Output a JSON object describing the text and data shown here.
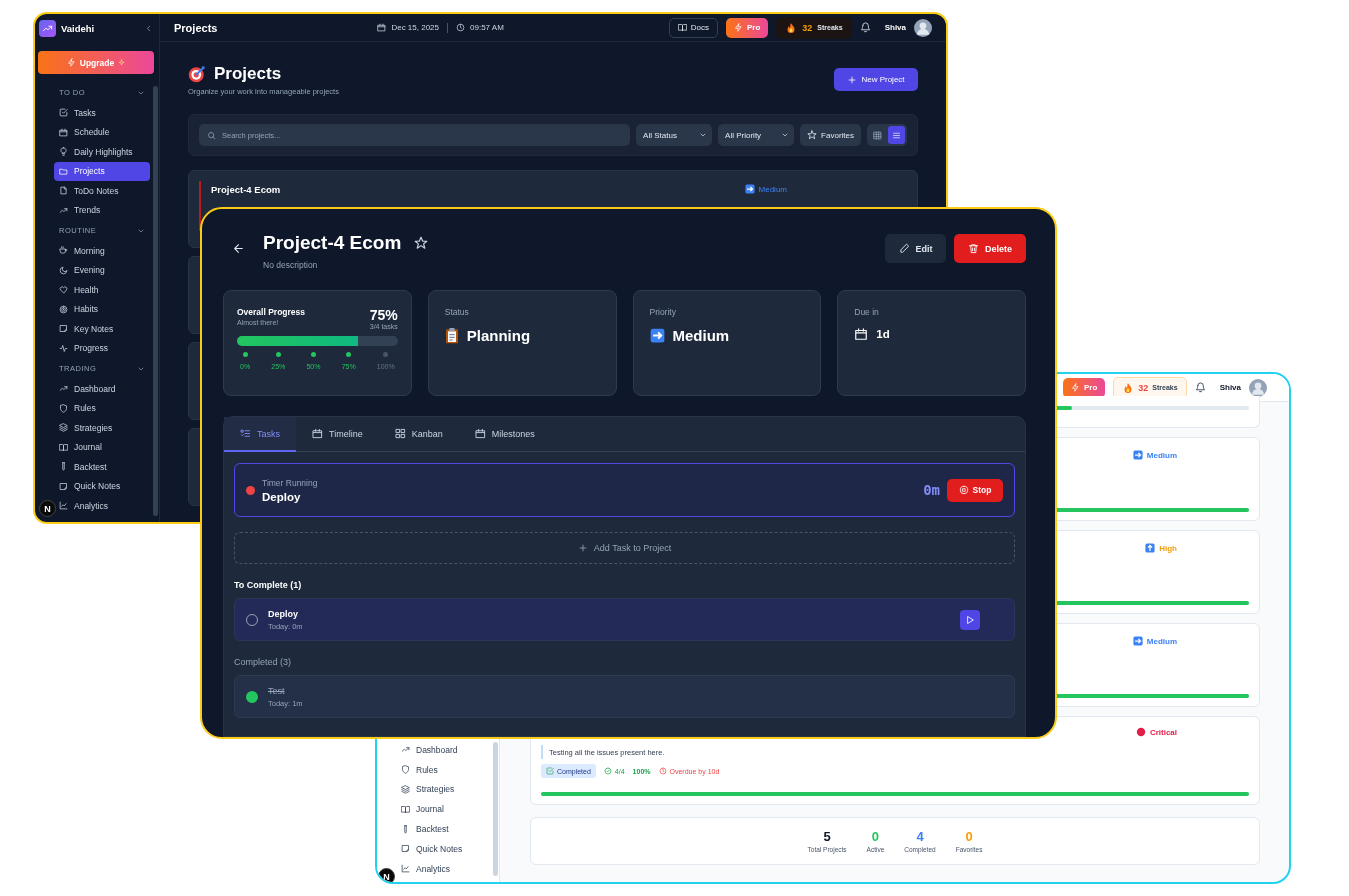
{
  "projects_window": {
    "brand": "Vaidehi",
    "page_title": "Projects",
    "date": "Dec 15, 2025",
    "time": "09:57 AM",
    "docs_button": "Docs",
    "pro_button": "Pro",
    "streak_count": "32",
    "streak_label": "Streaks",
    "user_name": "Shiva",
    "upgrade_button": "Upgrade",
    "sidebar": [
      {
        "title": "TO DO",
        "expanded": true,
        "items": [
          {
            "label": "Tasks",
            "selected": false
          },
          {
            "label": "Schedule",
            "selected": false
          },
          {
            "label": "Daily Highlights",
            "selected": false
          },
          {
            "label": "Projects",
            "selected": true
          },
          {
            "label": "ToDo Notes",
            "selected": false
          },
          {
            "label": "Trends",
            "selected": false
          }
        ]
      },
      {
        "title": "ROUTINE",
        "expanded": true,
        "items": [
          {
            "label": "Morning",
            "selected": false
          },
          {
            "label": "Evening",
            "selected": false
          },
          {
            "label": "Health",
            "selected": false
          },
          {
            "label": "Habits",
            "selected": false
          },
          {
            "label": "Key Notes",
            "selected": false
          },
          {
            "label": "Progress",
            "selected": false
          }
        ]
      },
      {
        "title": "TRADING",
        "expanded": true,
        "items": [
          {
            "label": "Dashboard",
            "selected": false
          },
          {
            "label": "Rules",
            "selected": false
          },
          {
            "label": "Strategies",
            "selected": false
          },
          {
            "label": "Journal",
            "selected": false
          },
          {
            "label": "Backtest",
            "selected": false
          },
          {
            "label": "Quick Notes",
            "selected": false
          },
          {
            "label": "Analytics",
            "selected": false
          }
        ]
      }
    ],
    "dev_badge": "N",
    "heading": "Projects",
    "subtitle": "Organize your work into manageable projects",
    "new_project_button": "New Project",
    "search": {
      "placeholder": "Search projects..."
    },
    "status_filter": "All Status",
    "priority_filter": "All Priority",
    "favorites_button": "Favorites",
    "view_modes": [
      {
        "kind": "grid",
        "selected": false
      },
      {
        "kind": "list",
        "selected": true
      }
    ],
    "project_card": {
      "name": "Project-4 Ecom",
      "priority": {
        "label": "Medium",
        "kind": "medium"
      }
    }
  },
  "overview_window": {
    "pro_button": "Pro",
    "streak_count": "32",
    "streak_label": "Streaks",
    "user_name": "Shiva",
    "sidebar_items": [
      "Dashboard",
      "Rules",
      "Strategies",
      "Journal",
      "Backtest",
      "Quick Notes",
      "Analytics"
    ],
    "dev_badge": "N",
    "project_cards": [
      {
        "level": 0.75
      },
      {
        "priority": {
          "label": "Medium",
          "kind": "medium"
        },
        "level": 1
      },
      {
        "priority": {
          "label": "High",
          "kind": "high"
        },
        "level": 1
      },
      {
        "priority": {
          "label": "Medium",
          "kind": "medium"
        },
        "level": 1
      },
      {
        "priority": {
          "label": "Critical",
          "kind": "critical"
        },
        "description": "Testing all the issues present here.",
        "status": "Completed",
        "tasks": "4/4",
        "percent": "100%",
        "due": "Overdue by 10d",
        "level": 1
      }
    ],
    "stats": [
      {
        "value": "5",
        "label": "Total Projects",
        "color": "#0f172a"
      },
      {
        "value": "0",
        "label": "Active",
        "color": "#22c55e"
      },
      {
        "value": "4",
        "label": "Completed",
        "color": "#3b82f6"
      },
      {
        "value": "0",
        "label": "Favorites",
        "color": "#f59e0b"
      }
    ]
  },
  "detail_window": {
    "title": "Project-4 Ecom",
    "favorite": false,
    "description": "No description",
    "edit_button": "Edit",
    "delete_button": "Delete",
    "progress": {
      "label": "Overall Progress",
      "note": "Almost there!",
      "percent": "75%",
      "tasks": "3/4 tasks",
      "level": 0.75,
      "milestones": [
        {
          "label": "0%",
          "reached": true
        },
        {
          "label": "25%",
          "reached": true
        },
        {
          "label": "50%",
          "reached": true
        },
        {
          "label": "75%",
          "reached": true
        },
        {
          "label": "100%",
          "reached": false
        }
      ]
    },
    "status": {
      "label": "Status",
      "value": "Planning"
    },
    "priority": {
      "label": "Priority",
      "value": "Medium",
      "kind": "medium"
    },
    "due": {
      "label": "Due in",
      "value": "1d"
    },
    "tabs": [
      {
        "label": "Tasks",
        "selected": true
      },
      {
        "label": "Timeline",
        "selected": false
      },
      {
        "label": "Kanban",
        "selected": false
      },
      {
        "label": "Milestones",
        "selected": false
      }
    ],
    "timer": {
      "label": "Timer Running",
      "task": "Deploy",
      "elapsed": "0m",
      "stop_button": "Stop"
    },
    "add_task_button": "Add Task to Project",
    "groups": [
      {
        "title": "To Complete (1)",
        "tasks": [
          {
            "name": "Deploy",
            "time": "Today: 0m",
            "done": false
          }
        ]
      },
      {
        "title": "Completed (3)",
        "tasks": [
          {
            "name": "Test",
            "time": "Today: 1m",
            "done": true
          }
        ]
      }
    ]
  }
}
